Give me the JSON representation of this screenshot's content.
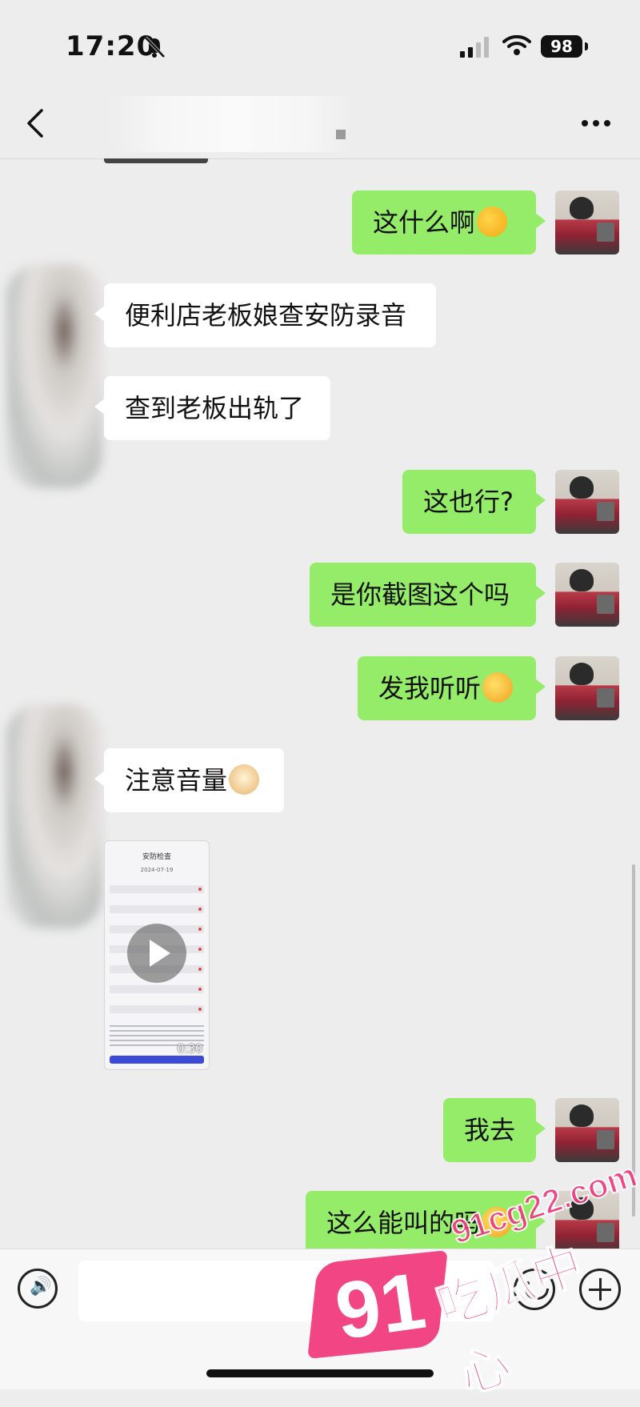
{
  "status_bar": {
    "time": "17:20",
    "battery": "98",
    "icons": [
      "bell-off-icon",
      "signal-icon",
      "wifi-icon",
      "battery-icon"
    ]
  },
  "nav": {
    "back_icon": "chevron-left-icon",
    "more_icon": "more-dots-icon"
  },
  "messages": [
    {
      "side": "out",
      "text": "这什么啊",
      "emoji": "thinking-face-icon"
    },
    {
      "side": "in",
      "text": "便利店老板娘查安防录音"
    },
    {
      "side": "in",
      "text": "查到老板出轨了"
    },
    {
      "side": "out",
      "text": "这也行?"
    },
    {
      "side": "out",
      "text": "是你截图这个吗"
    },
    {
      "side": "out",
      "text": "发我听听",
      "emoji": "laughing-face-icon"
    },
    {
      "side": "in",
      "text": "注意音量",
      "emoji": "doge-icon"
    },
    {
      "side": "in",
      "type": "video",
      "duration": "0:30"
    },
    {
      "side": "out",
      "text": "我去"
    },
    {
      "side": "out",
      "text": "这么能叫的吗",
      "emoji": "laughing-face-icon"
    }
  ],
  "video_thumb": {
    "header": "安防检查",
    "date": "2024-07-19"
  },
  "input_bar": {
    "placeholder": "",
    "icons": [
      "voice-icon",
      "emoji-icon",
      "plus-icon"
    ]
  },
  "watermark": {
    "number": "91",
    "domain": "91cg22.com",
    "text": "吃瓜中心",
    "color": "#f0357a"
  },
  "colors": {
    "outgoing_bubble": "#95ec69",
    "incoming_bubble": "#ffffff",
    "background": "#ededed"
  }
}
